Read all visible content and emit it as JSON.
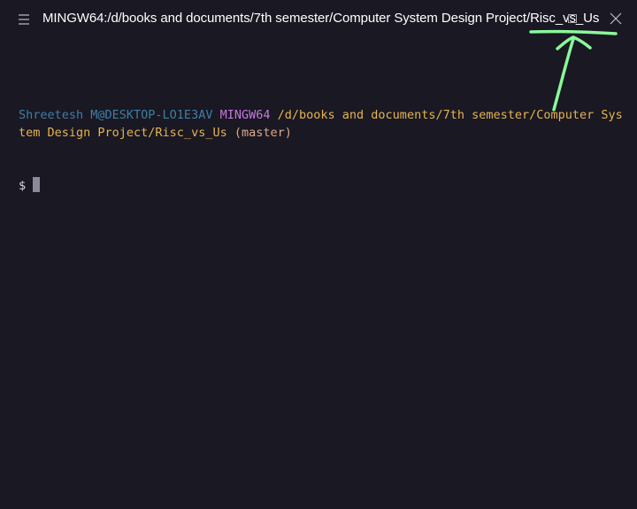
{
  "window": {
    "title": "MINGW64:/d/books and documents/7th semester/Computer System Design Project/Risc_vs_Us"
  },
  "terminal": {
    "user": "Shreetesh M@DESKTOP-LO1E3AV",
    "shell": "MINGW64",
    "path": "/d/books and documents/7th semester/Computer System Design Project/Risc_vs_Us",
    "branch": "(master)",
    "prompt_symbol": "$"
  },
  "icons": {
    "menu": "hamburger-menu-icon",
    "restore": "restore-icon",
    "close": "close-icon"
  },
  "colors": {
    "background": "#191823",
    "user": "#3f7fa5",
    "shell": "#c678dd",
    "path": "#e6b450",
    "annotation": "#8af79a"
  }
}
